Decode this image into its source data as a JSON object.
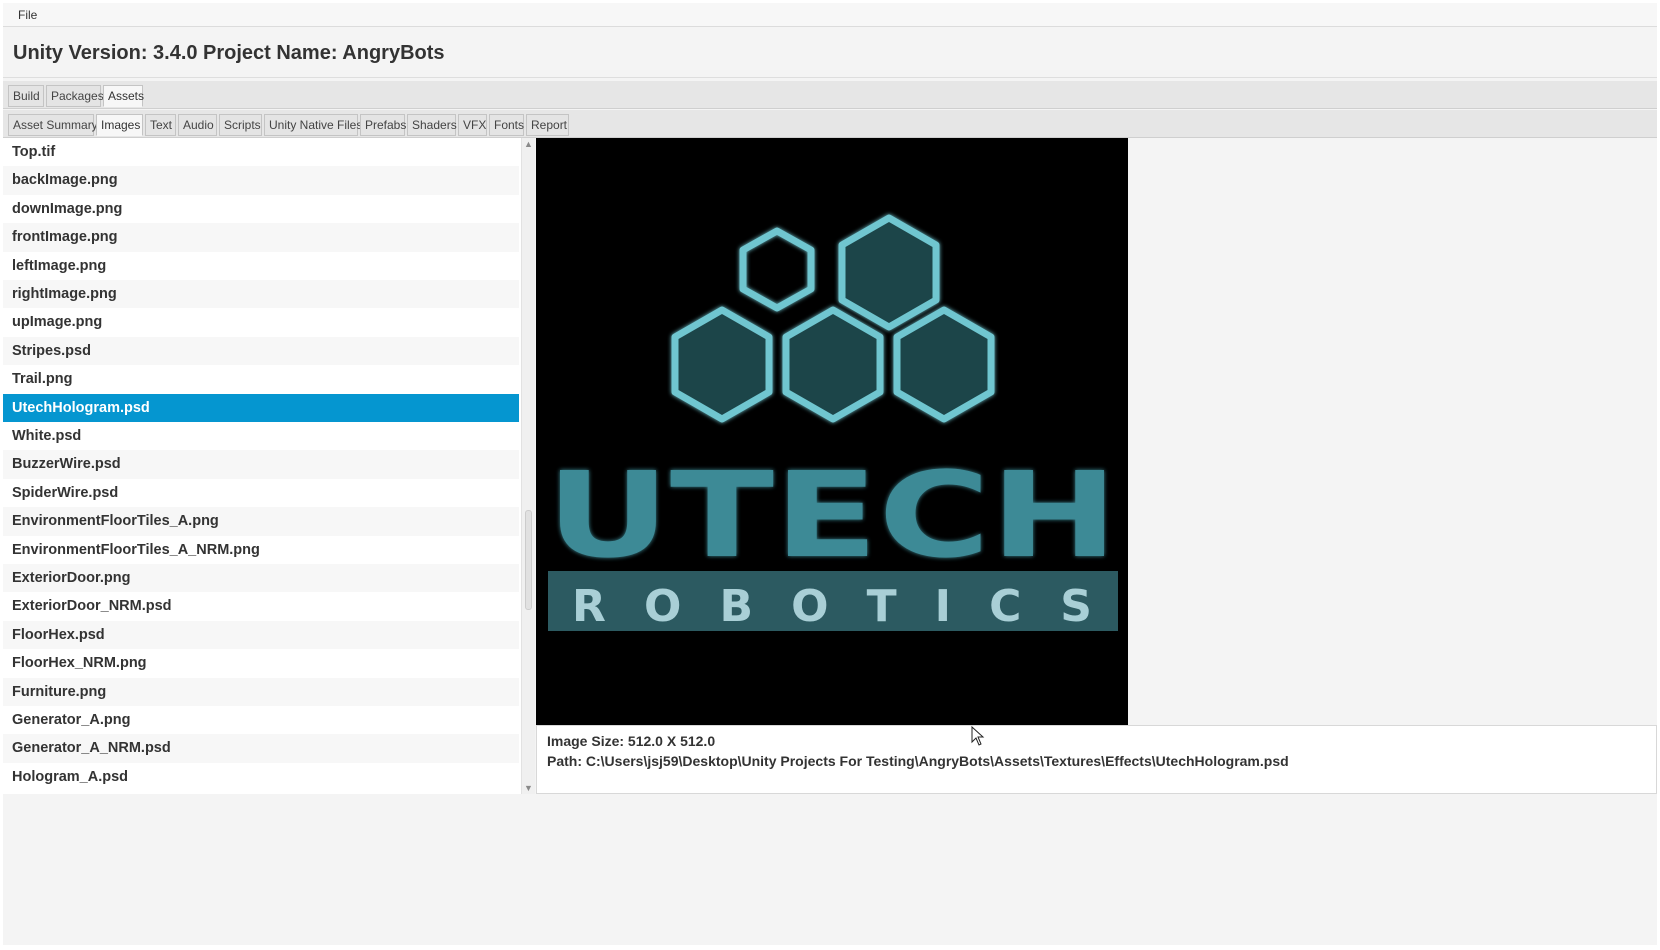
{
  "menubar": {
    "file": "File"
  },
  "header": {
    "unity_version": "Unity Version: 3.4.0",
    "project_name": "Project Name: AngryBots"
  },
  "main_tabs": [
    {
      "label": "Build",
      "selected": false
    },
    {
      "label": "Packages",
      "selected": false
    },
    {
      "label": "Assets",
      "selected": true
    }
  ],
  "sub_tabs": [
    {
      "label": "Asset Summary",
      "selected": false
    },
    {
      "label": "Images",
      "selected": true
    },
    {
      "label": "Text",
      "selected": false
    },
    {
      "label": "Audio",
      "selected": false
    },
    {
      "label": "Scripts",
      "selected": false
    },
    {
      "label": "Unity Native Files",
      "selected": false
    },
    {
      "label": "Prefabs",
      "selected": false
    },
    {
      "label": "Shaders",
      "selected": false
    },
    {
      "label": "VFX",
      "selected": false
    },
    {
      "label": "Fonts",
      "selected": false
    },
    {
      "label": "Report",
      "selected": false
    }
  ],
  "files": [
    "Top.tif",
    "backImage.png",
    "downImage.png",
    "frontImage.png",
    "leftImage.png",
    "rightImage.png",
    "upImage.png",
    "Stripes.psd",
    "Trail.png",
    "UtechHologram.psd",
    "White.psd",
    "BuzzerWire.psd",
    "SpiderWire.psd",
    "EnvironmentFloorTiles_A.png",
    "EnvironmentFloorTiles_A_NRM.png",
    "ExteriorDoor.png",
    "ExteriorDoor_NRM.psd",
    "FloorHex.psd",
    "FloorHex_NRM.png",
    "Furniture.png",
    "Generator_A.png",
    "Generator_A_NRM.psd",
    "Hologram_A.psd"
  ],
  "selected_file": "UtechHologram.psd",
  "preview": {
    "logo_title": "UTECH",
    "logo_subtitle": "ROBOTICS",
    "logo_color": "#3e8a96"
  },
  "info": {
    "image_size": "Image Size: 512.0 X 512.0",
    "path": "Path: C:\\Users\\jsj59\\Desktop\\Unity Projects For Testing\\AngryBots\\Assets\\Textures\\Effects\\UtechHologram.psd"
  },
  "colors": {
    "selection": "#0596d0",
    "preview_background": "#000000"
  }
}
